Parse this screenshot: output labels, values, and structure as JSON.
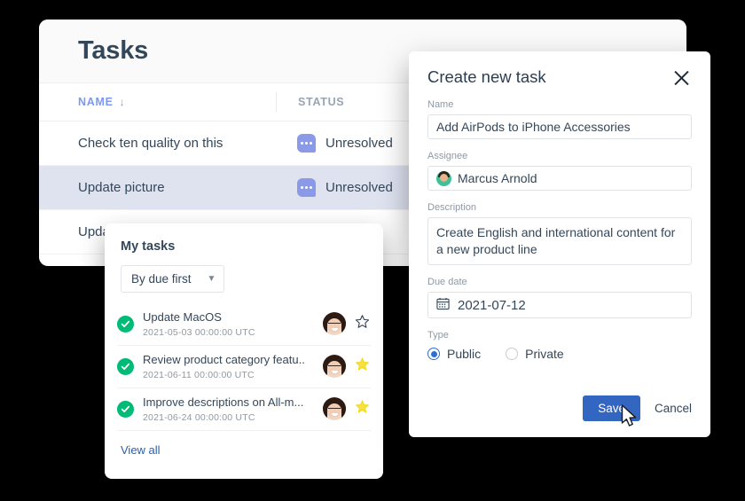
{
  "tasks_card": {
    "title": "Tasks",
    "columns": [
      "NAME",
      "STATUS"
    ],
    "sort_arrow": "↓",
    "rows": [
      {
        "name": "Check ten quality on this",
        "status": "Unresolved",
        "status_icon": "comment-bubble-icon",
        "selected": false
      },
      {
        "name": "Update picture",
        "status": "Unresolved",
        "status_icon": "comment-bubble-icon",
        "selected": true
      },
      {
        "name": "Upda",
        "status": "",
        "status_icon": "comment-bubble-icon",
        "selected": false
      }
    ]
  },
  "my_tasks": {
    "title": "My tasks",
    "sort": {
      "label": "By due first",
      "icon": "chevron-down-icon"
    },
    "items": [
      {
        "name": "Update MacOS",
        "date": "2021-05-03  00:00:00 UTC",
        "done": true,
        "starred": false,
        "star_icon": "star-outline-icon",
        "avatar": "avatar"
      },
      {
        "name": "Review product category featu..",
        "date": "2021-06-11  00:00:00 UTC",
        "done": true,
        "starred": true,
        "star_icon": "star-filled-icon",
        "avatar": "avatar"
      },
      {
        "name": "Improve descriptions on All-m...",
        "date": "2021-06-24  00:00:00 UTC",
        "done": true,
        "starred": true,
        "star_icon": "star-filled-icon",
        "avatar": "avatar"
      }
    ],
    "view_all": "View all"
  },
  "modal": {
    "title": "Create new task",
    "close_icon": "close-icon",
    "fields": {
      "name": {
        "label": "Name",
        "value": "Add AirPods to iPhone Accessories"
      },
      "assignee": {
        "label": "Assignee",
        "value": "Marcus Arnold",
        "avatar": "avatar"
      },
      "description": {
        "label": "Description",
        "value": "Create English and international content for a new product line"
      },
      "due_date": {
        "label": "Due date",
        "value": "2021-07-12",
        "icon": "calendar-icon"
      },
      "type": {
        "label": "Type",
        "selected": "Public",
        "options": [
          "Public",
          "Private"
        ]
      }
    },
    "save_label": "Save",
    "cancel_label": "Cancel"
  },
  "colors": {
    "accent_blue": "#3366c0",
    "link_blue": "#2a5fa8",
    "header_blue": "#7c98f0",
    "status_bubble": "#8a9ae8",
    "done_green": "#00bb77",
    "star_yellow": "#f7e13a",
    "row_selected": "#dfe3f0",
    "background": "#000000"
  }
}
